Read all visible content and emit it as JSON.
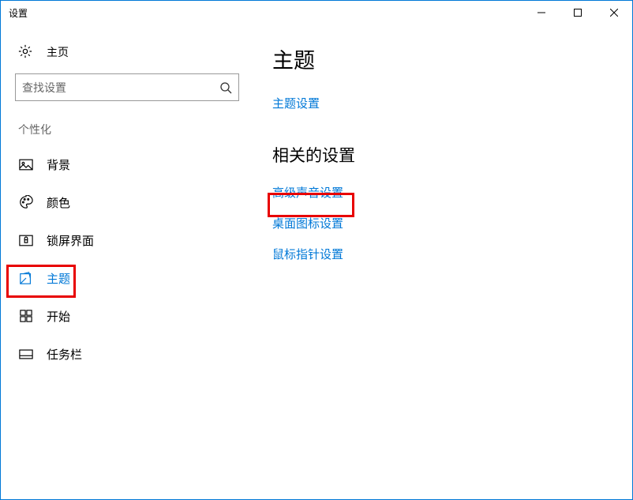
{
  "window": {
    "title": "设置"
  },
  "sidebar": {
    "home": "主页",
    "search_placeholder": "查找设置",
    "section": "个性化",
    "items": [
      {
        "label": "背景"
      },
      {
        "label": "颜色"
      },
      {
        "label": "锁屏界面"
      },
      {
        "label": "主题"
      },
      {
        "label": "开始"
      },
      {
        "label": "任务栏"
      }
    ]
  },
  "main": {
    "heading": "主题",
    "theme_settings": "主题设置",
    "related_heading": "相关的设置",
    "links": [
      "高级声音设置",
      "桌面图标设置",
      "鼠标指针设置"
    ]
  }
}
